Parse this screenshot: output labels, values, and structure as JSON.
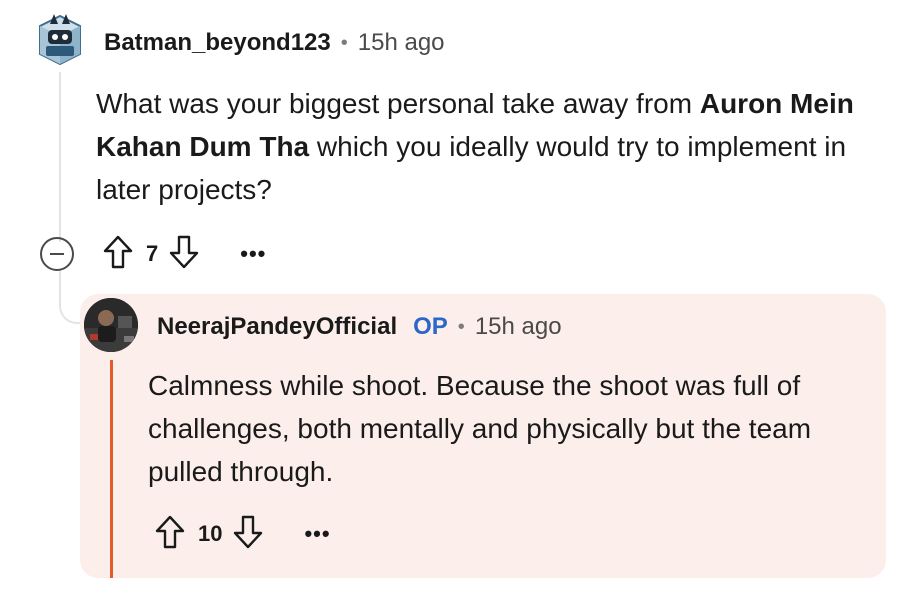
{
  "parent_comment": {
    "username": "Batman_beyond123",
    "separator": "•",
    "time": "15h ago",
    "body_parts": [
      "What was your biggest personal take away from ",
      "Auron Mein Kahan Dum Tha",
      " which you ideally would try to implement in later projects?"
    ],
    "votes": "7",
    "more_label": "•••"
  },
  "reply_comment": {
    "username": "NeerajPandeyOfficial",
    "op_badge": "OP",
    "separator": "•",
    "time": "15h ago",
    "body": "Calmness while shoot. Because the shoot was full of challenges, both mentally and physically but the team pulled through.",
    "votes": "10",
    "more_label": "•••",
    "accent_color": "#e45a2a",
    "background_color": "#fcefeb"
  },
  "icons": {
    "collapse": "minus-circle-icon",
    "upvote": "arrow-up-icon",
    "downvote": "arrow-down-icon"
  }
}
